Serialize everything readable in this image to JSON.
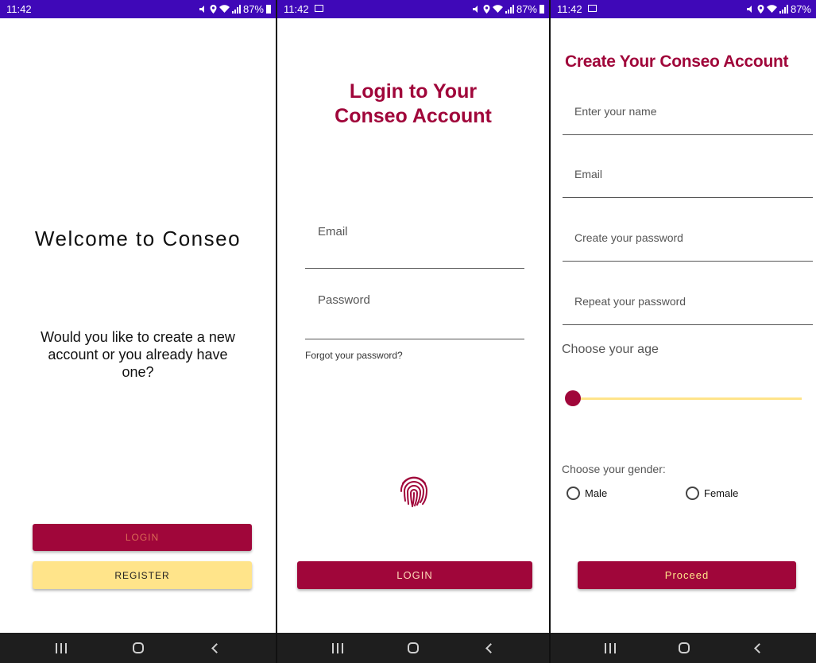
{
  "colors": {
    "status_bar": "#3f08b8",
    "primary": "#a0063a",
    "secondary": "#ffe48a",
    "nav_bar": "#1e1e1e"
  },
  "screens": [
    {
      "status": {
        "time": "11:42",
        "battery": "87%"
      },
      "title": "Welcome to Conseo",
      "question": "Would you like to create a new account or you already have one?",
      "login_button": "LOGIN",
      "register_button": "REGISTER"
    },
    {
      "status": {
        "time": "11:42",
        "battery": "87%"
      },
      "title_line1": "Login to Your",
      "title_line2": "Conseo Account",
      "email_placeholder": "Email",
      "password_placeholder": "Password",
      "forgot_link": "Forgot your password?",
      "login_button": "LOGIN"
    },
    {
      "status": {
        "time": "11:42",
        "battery": "87%"
      },
      "title": "Create Your Conseo Account",
      "name_placeholder": "Enter your name",
      "email_placeholder": "Email",
      "password_placeholder": "Create your password",
      "repeat_placeholder": "Repeat your password",
      "age_label": "Choose your age",
      "age_slider_fraction": 0,
      "gender_label": "Choose your gender:",
      "gender_options": [
        "Male",
        "Female"
      ],
      "proceed_button": "Proceed"
    }
  ]
}
